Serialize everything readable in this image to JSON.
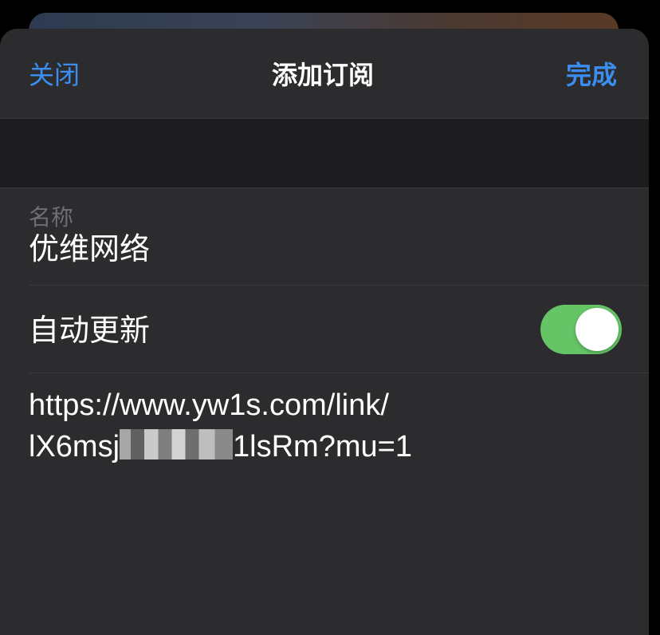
{
  "nav": {
    "close_label": "关闭",
    "title": "添加订阅",
    "done_label": "完成"
  },
  "form": {
    "name_label": "名称",
    "name_value": "优维网络",
    "auto_update_label": "自动更新",
    "auto_update_on": true,
    "url_line1": "https://www.yw1s.com/link/",
    "url_line2_prefix": "lX6msj",
    "url_line2_suffix": "1lsRm?mu=1"
  },
  "colors": {
    "accent": "#3b8ef0",
    "toggle_on": "#65c466",
    "sheet_bg": "#2c2c2e"
  }
}
